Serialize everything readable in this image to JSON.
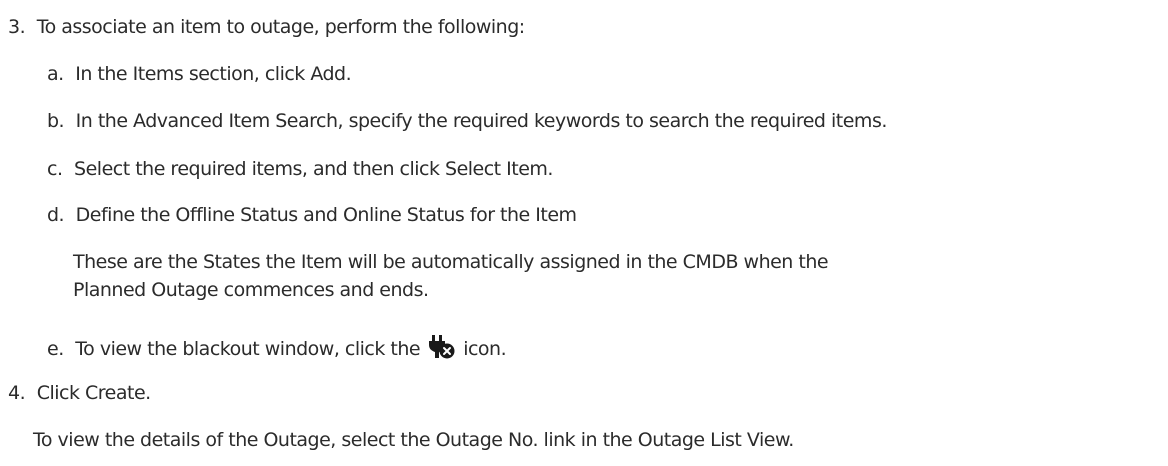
{
  "steps": {
    "step3": {
      "num": "3.",
      "text": "To associate an item to outage, perform the following:"
    },
    "sub": [
      {
        "letter": "a.",
        "text": "In the Items section, click Add."
      },
      {
        "letter": "b.",
        "text": "In the Advanced Item Search, specify the required keywords to search the required items."
      },
      {
        "letter": "c.",
        "text": "Select the required items, and then click Select Item."
      },
      {
        "letter": "d.",
        "text": "Define the Offline Status and Online Status for the Item"
      }
    ],
    "note_d_line1": "These are the States the Item will be automatically assigned in the CMDB when the",
    "note_d_line2": "Planned Outage commences and ends.",
    "step_e": {
      "letter": "e.",
      "before": "To view the blackout window, click the",
      "icon": "blackout-plug-icon",
      "after": "icon."
    },
    "step4": {
      "num": "4.",
      "text": "Click Create."
    },
    "final_note": "To view the details of the Outage, select the Outage No. link in the Outage List View."
  }
}
